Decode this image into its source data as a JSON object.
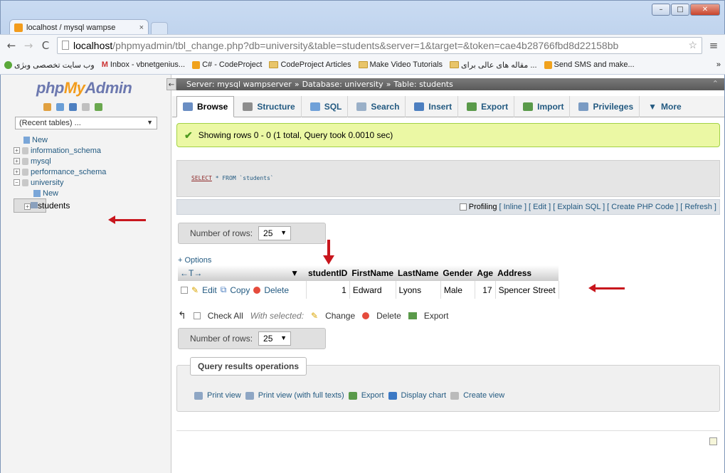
{
  "browser": {
    "tab_title": "localhost / mysql wampse",
    "tab_close": "×",
    "url_host": "localhost",
    "url_rest": "/phpmyadmin/tbl_change.php?db=university&table=students&server=1&target=&token=cae4b28766fbd8d22158bb",
    "bookmarks": [
      "وب سایت تخصصی وبژی",
      "Inbox - vbnetgenius...",
      "C# - CodeProject",
      "CodeProject Articles",
      "Make Video Tutorials",
      "مقاله های عالی برای ...",
      "Send SMS and make..."
    ],
    "bookmarks_more": "»"
  },
  "sidebar": {
    "logo_php": "php",
    "logo_my": "My",
    "logo_admin": "Admin",
    "recent_tables": "(Recent tables) ...",
    "tree": [
      {
        "label": "New",
        "level": 0
      },
      {
        "label": "information_schema",
        "level": 0
      },
      {
        "label": "mysql",
        "level": 0
      },
      {
        "label": "performance_schema",
        "level": 0
      },
      {
        "label": "university",
        "level": 0
      },
      {
        "label": "New",
        "level": 1
      },
      {
        "label": "students",
        "level": 1
      }
    ]
  },
  "breadcrumb": {
    "server": "Server: mysql wampserver",
    "database": "Database: university",
    "table": "Table: students",
    "sep": "»"
  },
  "tabs": [
    {
      "label": "Browse",
      "color": "#6a8ec3"
    },
    {
      "label": "Structure",
      "color": "#8d8d8d"
    },
    {
      "label": "SQL",
      "color": "#6fa0d8"
    },
    {
      "label": "Search",
      "color": "#9ab0c8"
    },
    {
      "label": "Insert",
      "color": "#4d7fc0"
    },
    {
      "label": "Export",
      "color": "#5a9a4a"
    },
    {
      "label": "Import",
      "color": "#5a9a4a"
    },
    {
      "label": "Privileges",
      "color": "#7a9bc3"
    },
    {
      "label": "More",
      "color": "#333333"
    }
  ],
  "message": "Showing rows 0 - 0 (1 total, Query took 0.0010 sec)",
  "sql": {
    "keyword": "SELECT",
    "rest": "* FROM `students`"
  },
  "sqltools": {
    "profiling": "Profiling",
    "inline": "[ Inline ]",
    "edit": "[ Edit ]",
    "explain": "[ Explain SQL ]",
    "create_php": "[ Create PHP Code ]",
    "refresh": "[ Refresh ]"
  },
  "nav": {
    "number_of_rows": "Number of rows:",
    "rows_value": "25"
  },
  "options_link": "+ Options",
  "table": {
    "arrows": "←T→",
    "sort_arrow": "▼",
    "columns": [
      "studentID",
      "FirstName",
      "LastName",
      "Gender",
      "Age",
      "Address"
    ],
    "rows": [
      {
        "edit": "Edit",
        "copy": "Copy",
        "delete": "Delete",
        "cells": [
          "1",
          "Edward",
          "Lyons",
          "Male",
          "17",
          "Spencer Street"
        ]
      }
    ]
  },
  "with_selected": {
    "check_all": "Check All",
    "label": "With selected:",
    "change": "Change",
    "delete": "Delete",
    "export": "Export"
  },
  "ops": {
    "legend": "Query results operations",
    "print_view": "Print view",
    "print_full": "Print view (with full texts)",
    "export": "Export",
    "display_chart": "Display chart",
    "create_view": "Create view"
  }
}
